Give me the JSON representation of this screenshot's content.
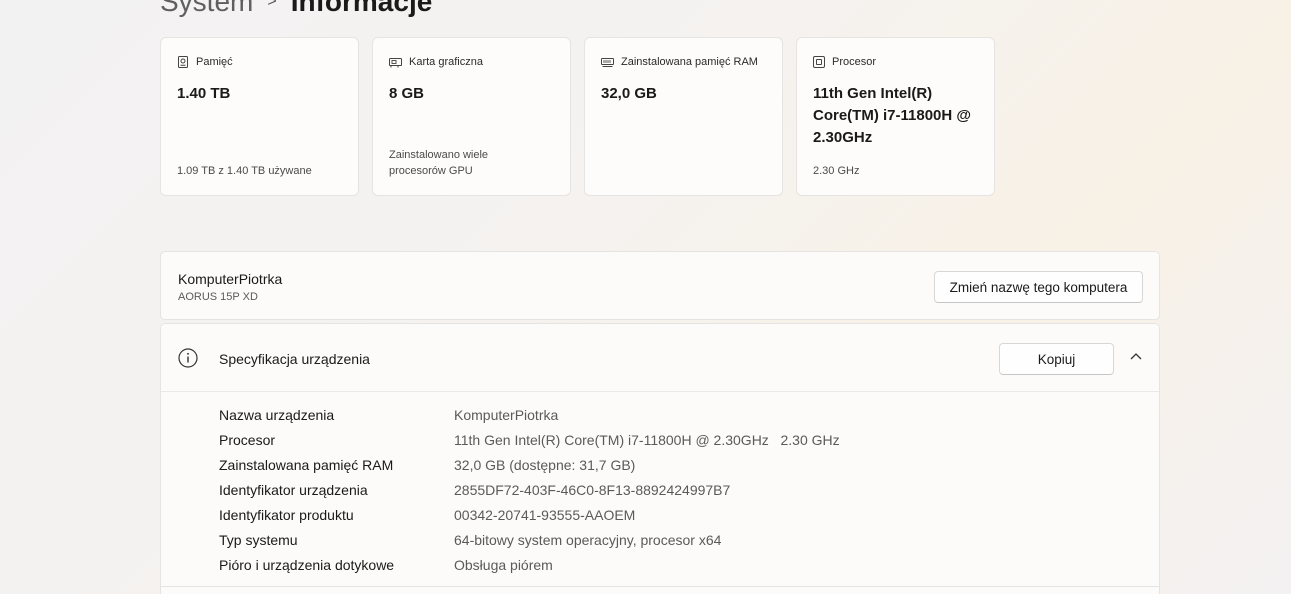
{
  "breadcrumb": {
    "parent": "System",
    "separator": ">",
    "current": "Informacje"
  },
  "cards": [
    {
      "icon": "storage-icon",
      "label": "Pamięć",
      "value": "1.40 TB",
      "sub": "1.09 TB z 1.40 TB używane"
    },
    {
      "icon": "gpu-icon",
      "label": "Karta graficzna",
      "value": "8 GB",
      "sub": "Zainstalowano wiele procesorów GPU"
    },
    {
      "icon": "ram-icon",
      "label": "Zainstalowana pamięć RAM",
      "value": "32,0 GB",
      "sub": ""
    },
    {
      "icon": "cpu-icon",
      "label": "Procesor",
      "value": "11th Gen Intel(R) Core(TM) i7-11800H @ 2.30GHz",
      "sub": "2.30 GHz"
    }
  ],
  "device": {
    "name": "KomputerPiotrka",
    "model": "AORUS 15P XD",
    "rename_label": "Zmień nazwę tego komputera"
  },
  "spec": {
    "icon": "info-icon",
    "title": "Specyfikacja urządzenia",
    "copy_label": "Kopiuj",
    "rows": [
      {
        "key": "Nazwa urządzenia",
        "value": "KomputerPiotrka"
      },
      {
        "key": "Procesor",
        "value": "11th Gen Intel(R) Core(TM) i7-11800H @ 2.30GHz   2.30 GHz"
      },
      {
        "key": "Zainstalowana pamięć RAM",
        "value": "32,0 GB (dostępne: 31,7 GB)"
      },
      {
        "key": "Identyfikator urządzenia",
        "value": "2855DF72-403F-46C0-8F13-8892424997B7"
      },
      {
        "key": "Identyfikator produktu",
        "value": "00342-20741-93555-AAOEM"
      },
      {
        "key": "Typ systemu",
        "value": "64-bitowy system operacyjny, procesor x64"
      },
      {
        "key": "Pióro i urządzenia dotykowe",
        "value": "Obsługa piórem"
      }
    ]
  }
}
